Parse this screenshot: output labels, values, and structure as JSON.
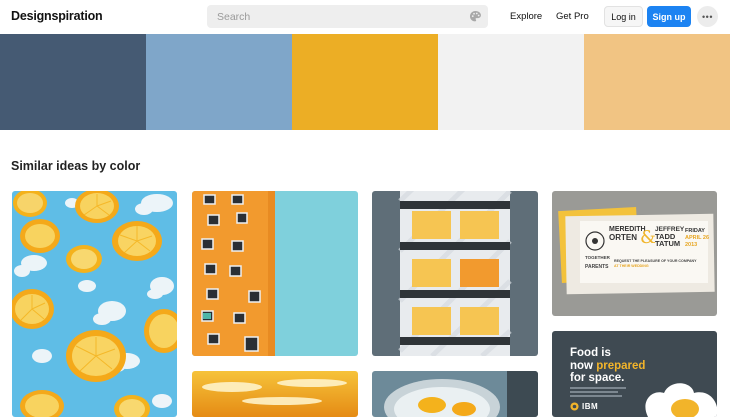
{
  "header": {
    "logo": "Designspiration",
    "search_placeholder": "Search",
    "nav": {
      "explore": "Explore",
      "get_pro": "Get Pro"
    },
    "login": "Log in",
    "signup": "Sign up",
    "more": "•••"
  },
  "palette": {
    "colors": [
      "#455a73",
      "#7fa6c9",
      "#ecae25",
      "#f2f2f2",
      "#f1c483"
    ]
  },
  "section": {
    "title": "Similar ideas by color"
  },
  "cards": {
    "invitation": {
      "name_left_1": "MEREDITH",
      "name_left_2": "ORTEN",
      "ampersand": "&",
      "name_right_1": "JEFFREY",
      "name_right_2": "TADD",
      "name_right_3": "TATUM",
      "day": "FRIDAY",
      "date": "APRIL 26 2013",
      "together": "TOGETHER",
      "parents": "PARENTS",
      "line1": "REQUEST THE PLEASURE OF YOUR COMPANY",
      "line2": "AT THEIR WEDDING"
    },
    "ad": {
      "headline_1": "Food is",
      "headline_2a": "now ",
      "headline_2b": "prepared",
      "headline_3": "for space.",
      "brand": "IBM"
    }
  },
  "icons": {
    "palette": "palette-icon",
    "more": "more-dots-icon"
  }
}
